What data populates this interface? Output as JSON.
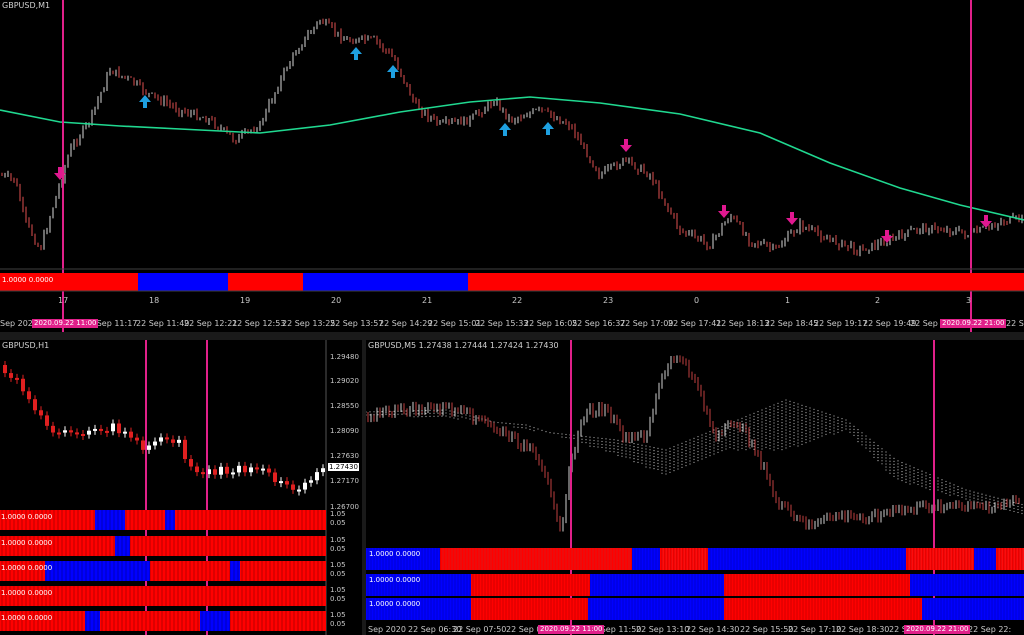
{
  "colors": {
    "background": "#000000",
    "candle_up": "#ffffff",
    "candle_down": "#e02020",
    "moving_average": "#20d890",
    "buy_arrow": "#1ea0e0",
    "sell_arrow": "#e01890",
    "vline": "#e0208a",
    "strip_red": "#ff0000",
    "strip_blue": "#0000ff"
  },
  "top_chart": {
    "title": "GBPUSD,M1",
    "strip_label": "1.0000 0.0000",
    "day_labels": [
      "17",
      "18",
      "19",
      "20",
      "21",
      "22",
      "23",
      "0",
      "1",
      "2",
      "3"
    ],
    "time_labels": [
      "Sep 2020",
      "22 Sep 11:17",
      "22 Sep 11:49",
      "22 Sep 12:21",
      "22 Sep 12:53",
      "22 Sep 13:25",
      "22 Sep 13:57",
      "22 Sep 14:29",
      "22 Sep 15:01",
      "22 Sep 15:33",
      "22 Sep 16:05",
      "22 Sep 16:37",
      "22 Sep 17:09",
      "22 Sep 17:41",
      "22 Sep 18:13",
      "22 Sep 18:45",
      "22 Sep 19:17",
      "22 Sep 19:49",
      "22 Sep 2",
      "22 Sep"
    ],
    "markers": [
      "2020.09.22 11:00",
      "2020.09.22 21:00"
    ]
  },
  "bottom_left": {
    "title": "GBPUSD,H1",
    "price_levels": [
      "1.29480",
      "1.29020",
      "1.28550",
      "1.28090",
      "1.27630",
      "1.27170",
      "1.26700"
    ],
    "current_price": "1.27430",
    "strip_labels": [
      "1.0000 0.0000",
      "1.0000 0.0000",
      "1.0000 0.0000",
      "1.0000 0.0000",
      "1.0000 0.0000"
    ],
    "strip_scale": [
      "1.05",
      "0.05",
      "1.05",
      "0.05",
      "1.05",
      "0.05",
      "1.05",
      "0.05",
      "1.05",
      "0.05"
    ]
  },
  "bottom_right": {
    "title": "GBPUSD,M5  1.27438 1.27444 1.27424 1.27430",
    "strip_labels": [
      "1.0000 0.0000",
      "1.0000 0.0000",
      "1.0000 0.0000"
    ],
    "time_labels": [
      "Sep 2020",
      "22 Sep 06:30",
      "22 Sep 07:50",
      "22 Sep 09:1",
      "22 Sep 11:50",
      "22 Sep 13:10",
      "22 Sep 14:30",
      "22 Sep 15:50",
      "22 Sep 17:10",
      "22 Sep 18:30",
      "22 S",
      "21:10",
      "22 Sep 22:"
    ],
    "markers": [
      "2020.09.22 11:00",
      "2020.09.22 21:00"
    ]
  }
}
